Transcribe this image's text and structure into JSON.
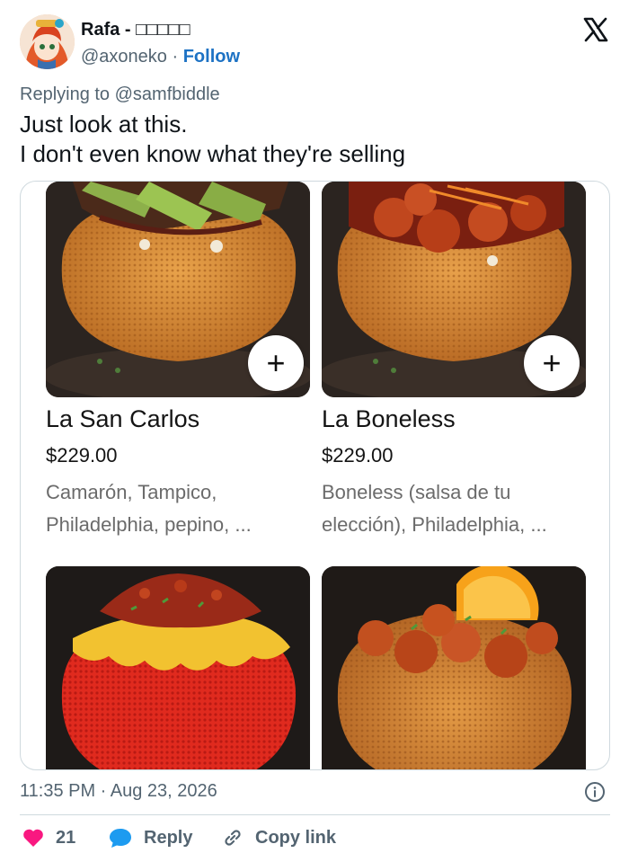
{
  "tweet": {
    "display_name": "Rafa - □□□□□",
    "handle": "@axoneko",
    "separator": " · ",
    "follow_label": "Follow",
    "replying_to": "Replying to @samfbiddle",
    "text_lines": [
      "Just look at this.",
      "I don't even know what they're selling"
    ],
    "timestamp": "11:35 PM · Aug 23, 2026",
    "icons": {
      "avatar": "anime-avatar",
      "brand": "x-logo-icon",
      "info": "info-icon"
    }
  },
  "menu": {
    "items": [
      {
        "title": "La San Carlos",
        "price": "$229.00",
        "desc_lines": [
          "Camarón, Tampico,",
          "Philadelphia, pepino, ..."
        ],
        "add_label": "+"
      },
      {
        "title": "La Boneless",
        "price": "$229.00",
        "desc_lines": [
          "Boneless (salsa de tu",
          "elección), Philadelphia, ..."
        ],
        "add_label": "+"
      }
    ]
  },
  "actions": {
    "like_count": "21",
    "reply_label": "Reply",
    "copy_label": "Copy link",
    "icons": {
      "like": "heart-icon",
      "reply": "speech-bubble-icon",
      "copy": "link-icon"
    }
  },
  "colors": {
    "like": "#f91880",
    "reply_icon": "#1d9bf0",
    "follow": "#1d72c4",
    "muted": "#536471",
    "border": "#cfd9de"
  }
}
